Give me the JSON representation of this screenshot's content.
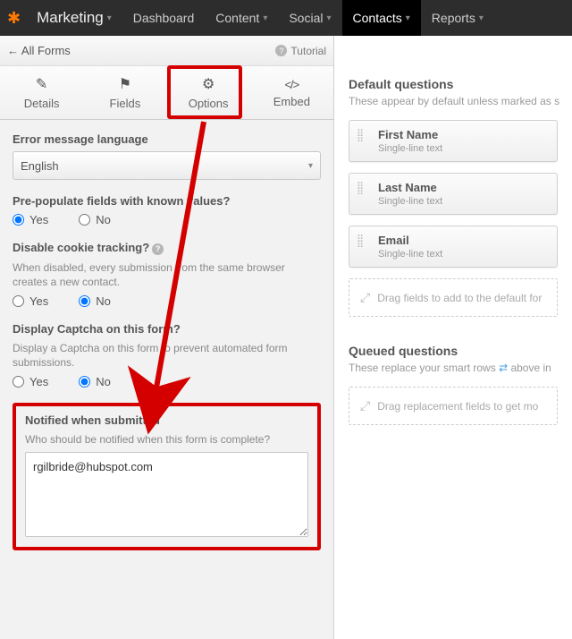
{
  "topnav": {
    "items": [
      {
        "label": "Marketing",
        "has_caret": true
      },
      {
        "label": "Dashboard",
        "has_caret": false
      },
      {
        "label": "Content",
        "has_caret": true
      },
      {
        "label": "Social",
        "has_caret": true
      },
      {
        "label": "Contacts",
        "has_caret": true,
        "active": true
      },
      {
        "label": "Reports",
        "has_caret": true
      }
    ]
  },
  "toprow": {
    "back": "All Forms",
    "tutorial": "Tutorial"
  },
  "subtabs": [
    {
      "label": "Details"
    },
    {
      "label": "Fields"
    },
    {
      "label": "Options",
      "active": true
    },
    {
      "label": "Embed"
    }
  ],
  "options": {
    "language_label": "Error message language",
    "language_value": "English",
    "prepop_label": "Pre-populate fields with known values?",
    "yes": "Yes",
    "no": "No",
    "prepop_value": "Yes",
    "cookie_label": "Disable cookie tracking?",
    "cookie_help": "When disabled, every submission from the same browser creates a new contact.",
    "cookie_value": "No",
    "captcha_label": "Display Captcha on this form?",
    "captcha_help": "Display a Captcha on this form to prevent automated form submissions.",
    "captcha_value": "No",
    "notify_label": "Notified when submitted",
    "notify_help": "Who should be notified when this form is complete?",
    "notify_value": "rgilbride@hubspot.com"
  },
  "right": {
    "default_title": "Default questions",
    "default_sub": "These appear by default unless marked as s",
    "fields": [
      {
        "name": "First Name",
        "type": "Single-line text"
      },
      {
        "name": "Last Name",
        "type": "Single-line text"
      },
      {
        "name": "Email",
        "type": "Single-line text"
      }
    ],
    "drop_default": "Drag fields to add to the default for",
    "queued_title": "Queued questions",
    "queued_sub_a": "These replace your smart rows ",
    "queued_sub_b": " above in ",
    "drop_queued": "Drag replacement fields to get mo"
  }
}
